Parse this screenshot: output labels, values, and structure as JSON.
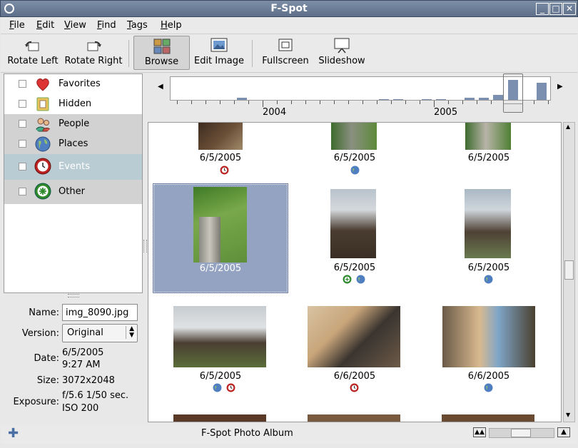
{
  "window": {
    "title": "F-Spot"
  },
  "menu": [
    "File",
    "Edit",
    "View",
    "Find",
    "Tags",
    "Help"
  ],
  "toolbar": {
    "rotate_left": "Rotate Left",
    "rotate_right": "Rotate Right",
    "browse": "Browse",
    "edit_image": "Edit Image",
    "fullscreen": "Fullscreen",
    "slideshow": "Slideshow"
  },
  "tags": [
    {
      "label": "Favorites",
      "icon": "heart-icon"
    },
    {
      "label": "Hidden",
      "icon": "hidden-icon"
    },
    {
      "label": "People",
      "icon": "people-icon"
    },
    {
      "label": "Places",
      "icon": "globe-icon"
    },
    {
      "label": "Events",
      "icon": "clock-icon"
    },
    {
      "label": "Other",
      "icon": "other-icon"
    }
  ],
  "properties": {
    "name_label": "Name:",
    "name_value": "img_8090.jpg",
    "version_label": "Version:",
    "version_value": "Original",
    "date_label": "Date:",
    "date_line1": "6/5/2005",
    "date_line2": "9:27 AM",
    "size_label": "Size:",
    "size_value": "3072x2048",
    "exposure_label": "Exposure:",
    "exposure_line1": "f/5.6 1/50 sec.",
    "exposure_line2": "ISO 200"
  },
  "timeline": {
    "years": [
      "2004",
      "2005"
    ]
  },
  "photos": [
    {
      "date": "6/5/2005",
      "tags": [
        "clock-icon"
      ]
    },
    {
      "date": "6/5/2005",
      "tags": [
        "globe-icon"
      ]
    },
    {
      "date": "6/5/2005",
      "tags": []
    },
    {
      "date": "6/5/2005",
      "tags": [],
      "selected": true
    },
    {
      "date": "6/5/2005",
      "tags": [
        "other-icon",
        "globe-icon"
      ]
    },
    {
      "date": "6/5/2005",
      "tags": [
        "globe-icon"
      ]
    },
    {
      "date": "6/5/2005",
      "tags": [
        "globe-icon",
        "clock-icon"
      ]
    },
    {
      "date": "6/6/2005",
      "tags": [
        "clock-icon"
      ]
    },
    {
      "date": "6/6/2005",
      "tags": [
        "globe-icon"
      ]
    }
  ],
  "status": {
    "text": "F-Spot Photo Album"
  },
  "colors": {
    "selection": "#94a3c2",
    "titlebar": "#6b7d98",
    "events_highlight": "#b9ccd4"
  }
}
